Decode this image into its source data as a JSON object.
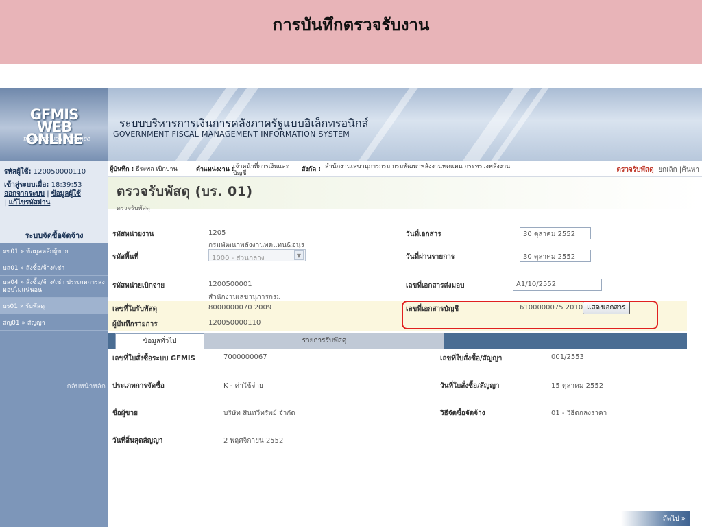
{
  "slide_title": "การบันทึกตรวจรับงาน",
  "logo": {
    "main": "GFMIS\nWEB ONLINE",
    "sub": "mobilize your finance"
  },
  "system": {
    "title_th": "ระบบบริหารการเงินการคลังภาครัฐแบบอิเล็กทรอนิกส์",
    "title_en": "GOVERNMENT FISCAL MANAGEMENT INFORMATION SYSTEM"
  },
  "infobar": {
    "recorder_label": "ผู้บันทึก :",
    "recorder_value": "ธีระพล เบิกบาน",
    "position_label": "ตำแหน่งงาน :",
    "position_value": "เจ้าหน้าที่การเงินและบัญชี",
    "affiliation_label": "สังกัด :",
    "affiliation_value": "สำนักงานเลขานุการกรม กรมพัฒนาพลังงานทดแทน กระทรวงพลังงาน",
    "links": {
      "active": "ตรวจรับพัสดุ",
      "cancel": "ยกเลิก",
      "search": "ค้นหา"
    }
  },
  "sidebar": {
    "user_label": "รหัสผู้ใช้:",
    "user_id": "120050000110",
    "login_label": "เข้าสู่ระบบเมื่อ:",
    "login_time": "18:39:53",
    "link_logout": "ออกจากระบบ",
    "link_userinfo": "ข้อมูลผู้ใช้",
    "link_password": "แก้ไขรหัสผ่าน",
    "section_title": "ระบบจัดซื้อจัดจ้าง",
    "items": [
      {
        "code": "ผข01 »",
        "label": "ข้อมูลหลักผู้ขาย"
      },
      {
        "code": "บส01 »",
        "label": "สั่งซื้อ/จ้าง/เช่า"
      },
      {
        "code": "บส04 »",
        "label": "สั่งซื้อ/จ้าง/เช่า ประเภทการส่งมอบไม่แน่นอน"
      },
      {
        "code": "บร01 »",
        "label": "รับพัสดุ"
      },
      {
        "code": "สญ01 »",
        "label": "สัญญา"
      }
    ],
    "home": "กลับหน้าหลัก"
  },
  "page": {
    "title": "ตรวจรับพัสดุ (บร. 01)",
    "subtitle": "ตรวจรับพัสดุ"
  },
  "form": {
    "unit_code_label": "รหัสหน่วยงาน",
    "unit_code": "1205",
    "unit_name": "กรมพัฒนาพลังงานทดแทน&อนุร",
    "doc_date_label": "วันที่เอกสาร",
    "doc_date": "30 ตุลาคม 2552",
    "area_label": "รหัสพื้นที่",
    "area_value": "1000 - ส่วนกลาง",
    "post_date_label": "วันที่ผ่านรายการ",
    "post_date": "30 ตุลาคม 2552",
    "disb_unit_label": "รหัสหน่วยเบิกจ่าย",
    "disb_unit": "1200500001",
    "disb_unit_name": "สำนักงานเลขานุการกรม",
    "delivery_doc_label": "เลขที่เอกสารส่งมอบ",
    "delivery_doc": "A1/10/2552",
    "receipt_no_label": "เลขที่ใบรับพัสดุ",
    "receipt_no": "8000000070 2009",
    "acct_doc_label": "เลขที่เอกสารบัญชี",
    "acct_doc": "6100000075 2010",
    "show_doc_button": "แสดงเอกสาร",
    "recorder_label": "ผู้บันทึกรายการ",
    "recorder": "120050000110"
  },
  "tabs": {
    "general": "ข้อมูลทั่วไป",
    "items": "รายการรับพัสดุ"
  },
  "detail": {
    "po_gfmis_label": "เลขที่ใบสั่งซื้อระบบ GFMIS",
    "po_gfmis": "7000000067",
    "po_contract_label": "เลขที่ใบสั่งซื้อ/สัญญา",
    "po_contract": "001/2553",
    "purchase_type_label": "ประเภทการจัดซื้อ",
    "purchase_type": "K - ค่าใช้จ่าย",
    "po_date_label": "วันที่ใบสั่งซื้อ/สัญญา",
    "po_date": "15 ตุลาคม 2552",
    "vendor_label": "ชื่อผู้ขาย",
    "vendor": "บริษัท สินทวีทรัพย์ จำกัด",
    "method_label": "วิธีจัดซื้อจัดจ้าง",
    "method": "01 - วิธีตกลงราคา",
    "end_date_label": "วันที่สิ้นสุดสัญญา",
    "end_date": "2 พฤศจิกายน 2552"
  },
  "next_button": "ถัดไป »"
}
